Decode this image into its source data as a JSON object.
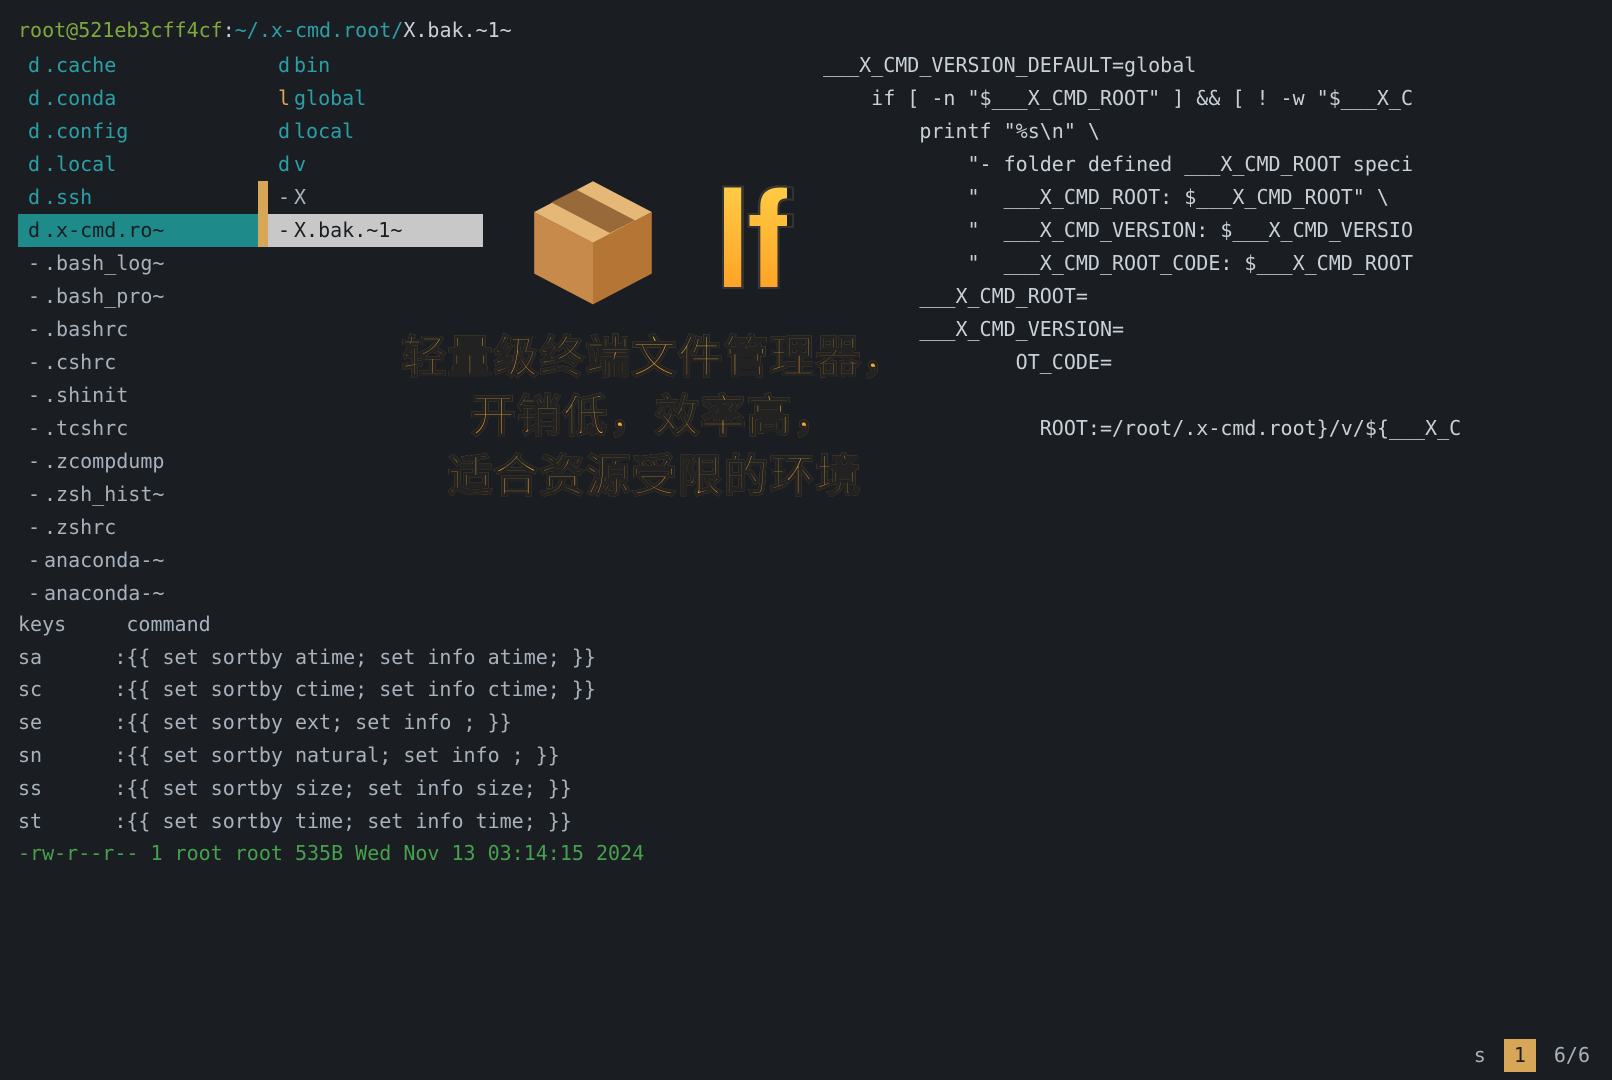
{
  "path": {
    "user": "root",
    "at": "@",
    "host": "521eb3cff4cf",
    "colon": ":",
    "cwd": "~/.x-cmd.root/",
    "file": "X.bak.~1~"
  },
  "col1": [
    {
      "t": "d",
      "n": ".cache",
      "cls": "dir"
    },
    {
      "t": "d",
      "n": ".conda",
      "cls": "dir"
    },
    {
      "t": "d",
      "n": ".config",
      "cls": "dir"
    },
    {
      "t": "d",
      "n": ".local",
      "cls": "dir"
    },
    {
      "t": "d",
      "n": ".ssh",
      "cls": "dir"
    },
    {
      "t": "d",
      "n": ".x-cmd.ro~",
      "cls": "dir",
      "sel": true
    },
    {
      "t": "-",
      "n": ".bash_log~",
      "cls": "file"
    },
    {
      "t": "-",
      "n": ".bash_pro~",
      "cls": "file"
    },
    {
      "t": "-",
      "n": ".bashrc",
      "cls": "file"
    },
    {
      "t": "-",
      "n": ".cshrc",
      "cls": "file"
    },
    {
      "t": "-",
      "n": ".shinit",
      "cls": "file"
    },
    {
      "t": "-",
      "n": ".tcshrc",
      "cls": "file"
    },
    {
      "t": "-",
      "n": ".zcompdump",
      "cls": "file"
    },
    {
      "t": "-",
      "n": ".zsh_hist~",
      "cls": "file"
    },
    {
      "t": "-",
      "n": ".zshrc",
      "cls": "file"
    },
    {
      "t": "-",
      "n": "anaconda-~",
      "cls": "file"
    },
    {
      "t": "-",
      "n": "anaconda-~",
      "cls": "file"
    }
  ],
  "col2": [
    {
      "t": "d",
      "n": "bin",
      "cls": "dir"
    },
    {
      "t": "l",
      "n": "global",
      "cls": "lnk"
    },
    {
      "t": "d",
      "n": "local",
      "cls": "dir"
    },
    {
      "t": "d",
      "n": "v",
      "cls": "dir"
    },
    {
      "t": "-",
      "n": "X",
      "cls": "file",
      "ind": true
    },
    {
      "t": "-",
      "n": "X.bak.~1~",
      "cls": "file",
      "sel": true,
      "ind": true
    }
  ],
  "preview": [
    "___X_CMD_VERSION_DEFAULT=global",
    "    if [ -n \"$___X_CMD_ROOT\" ] && [ ! -w \"$___X_C",
    "        printf \"%s\\n\" \\",
    "            \"- folder defined ___X_CMD_ROOT speci",
    "            \"  ___X_CMD_ROOT: $___X_CMD_ROOT\" \\",
    "            \"  ___X_CMD_VERSION: $___X_CMD_VERSIO",
    "            \"  ___X_CMD_ROOT_CODE: $___X_CMD_ROOT",
    "        ___X_CMD_ROOT=",
    "        ___X_CMD_VERSION=",
    "                OT_CODE=",
    "",
    "                  ROOT:=/root/.x-cmd.root}/v/${___X_C"
  ],
  "help": {
    "head_keys": "keys",
    "head_cmd": "command",
    "rows": [
      {
        "k": "sa",
        "c": ":{{ set sortby atime; set info atime; }}"
      },
      {
        "k": "sc",
        "c": ":{{ set sortby ctime; set info ctime; }}"
      },
      {
        "k": "se",
        "c": ":{{ set sortby ext; set info ; }}"
      },
      {
        "k": "sn",
        "c": ":{{ set sortby natural; set info ; }}"
      },
      {
        "k": "ss",
        "c": ":{{ set sortby size; set info size; }}"
      },
      {
        "k": "st",
        "c": ":{{ set sortby time; set info time; }}"
      }
    ]
  },
  "status": "-rw-r--r-- 1 root root 535B Wed Nov 13 03:14:15 2024",
  "footer": {
    "mode": "s",
    "badge": "1",
    "count": "6/6"
  },
  "overlay": {
    "logo": "lf",
    "line1": "轻量级终端文件管理器，",
    "line2": "开销低，效率高，",
    "line3": "适合资源受限的环境"
  }
}
